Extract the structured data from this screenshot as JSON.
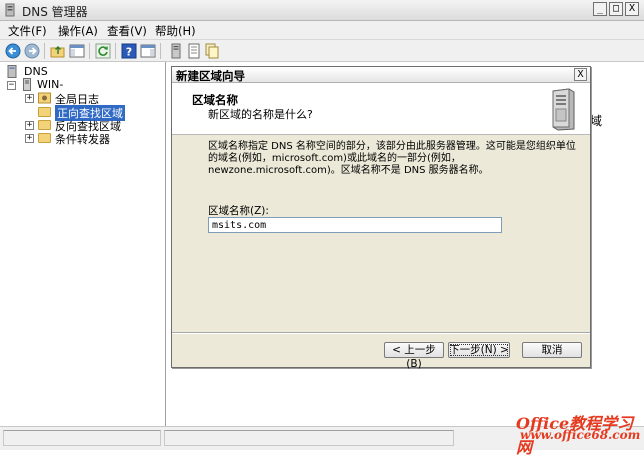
{
  "window": {
    "title": "DNS 管理器",
    "controls": {
      "minimize": "_",
      "maximize": "□",
      "close": "X"
    }
  },
  "menubar": {
    "items": [
      {
        "label": "文件(F)"
      },
      {
        "label": "操作(A)"
      },
      {
        "label": "查看(V)"
      },
      {
        "label": "帮助(H)"
      }
    ]
  },
  "toolbar": {
    "icons": [
      "back-arrow-icon",
      "forward-arrow-icon",
      "up-folder-icon",
      "show-hide-tree-icon",
      "refresh-icon",
      "help-icon",
      "action-pane-icon",
      "server-icon",
      "document-icon",
      "copy-icon"
    ]
  },
  "tree": {
    "root": "DNS",
    "server": "WIN-",
    "items": [
      {
        "label": "全局日志",
        "expander": "+"
      },
      {
        "label": "正向查找区域",
        "expander": ""
      },
      {
        "label": "反向查找区域",
        "expander": "+"
      },
      {
        "label": "条件转发器",
        "expander": "+"
      }
    ]
  },
  "right_pane": {
    "fragment": "域"
  },
  "wizard": {
    "title": "新建区域向导",
    "close": "X",
    "header_title": "区域名称",
    "header_subtitle": "新区域的名称是什么?",
    "description": "区域名称指定 DNS 名称空间的部分，该部分由此服务器管理。这可能是您组织单位的域名(例如，microsoft.com)或此域名的一部分(例如，newzone.microsoft.com)。区域名称不是 DNS 服务器名称。",
    "zone_name_label": "区域名称(Z):",
    "zone_name_value": "msits.com",
    "buttons": {
      "back": "< 上一步(B)",
      "next": "下一步(N) >",
      "cancel": "取消"
    }
  },
  "watermark": {
    "line1": "Office教程学习网",
    "line2": "www.office68.com"
  },
  "colors": {
    "dialog_bg": "#ece9d8",
    "selection": "#316ac5",
    "watermark": "#e53a1f"
  }
}
